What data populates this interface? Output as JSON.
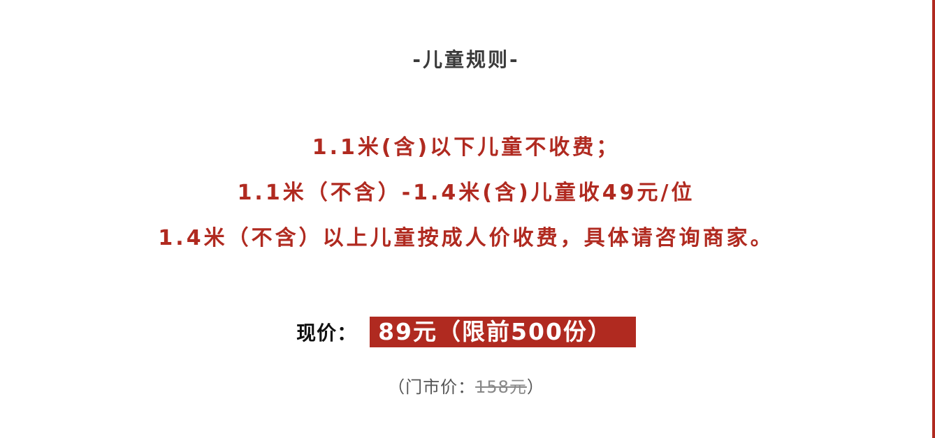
{
  "section_title": "-儿童规则-",
  "rules": [
    "1.1米(含)以下儿童不收费；",
    "1.1米（不含）-1.4米(含)儿童收49元/位",
    "1.4米（不含）以上儿童按成人价收费，具体请咨询商家。"
  ],
  "price": {
    "label": "现价：",
    "value": "89元（限前500份）"
  },
  "market_price": {
    "prefix": "（门市价：",
    "value": "158元",
    "suffix": "）"
  },
  "colors": {
    "accent": "#b02a20",
    "title_text": "#3a3a3a",
    "label_text": "#111111",
    "muted_text": "#555555"
  }
}
